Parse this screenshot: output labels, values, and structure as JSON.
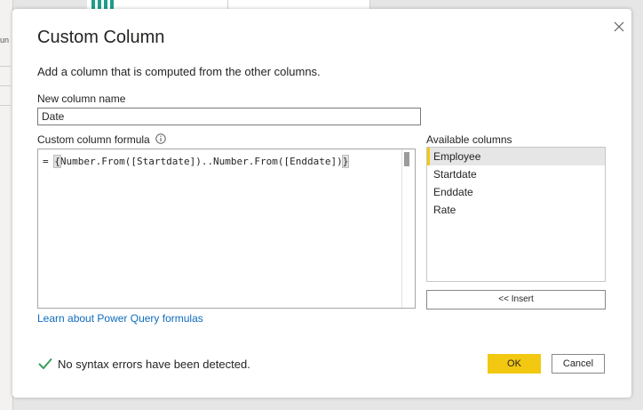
{
  "background": {
    "cut_label": "un"
  },
  "dialog": {
    "title": "Custom Column",
    "subtitle": "Add a column that is computed from the other columns.",
    "new_column_label": "New column name",
    "new_column_value": "Date",
    "formula_label": "Custom column formula",
    "formula_prefix": "= ",
    "formula_open": "{",
    "formula_body": "Number.From([Startdate])..Number.From([Enddate])",
    "formula_close": "}",
    "available_label": "Available columns",
    "available_columns": [
      "Employee",
      "Startdate",
      "Enddate",
      "Rate"
    ],
    "selected_column": "Employee",
    "insert_label": "<< Insert",
    "learn_link": "Learn about Power Query formulas",
    "status": "No syntax errors have been detected.",
    "ok_label": "OK",
    "cancel_label": "Cancel"
  },
  "colors": {
    "accent": "#f2c811",
    "link": "#0f6cbd",
    "success": "#3a9d5d",
    "bg_chart": "#1f9e8a"
  },
  "icons": {
    "close": "close-icon",
    "info": "info-icon",
    "check": "checkmark-icon"
  }
}
